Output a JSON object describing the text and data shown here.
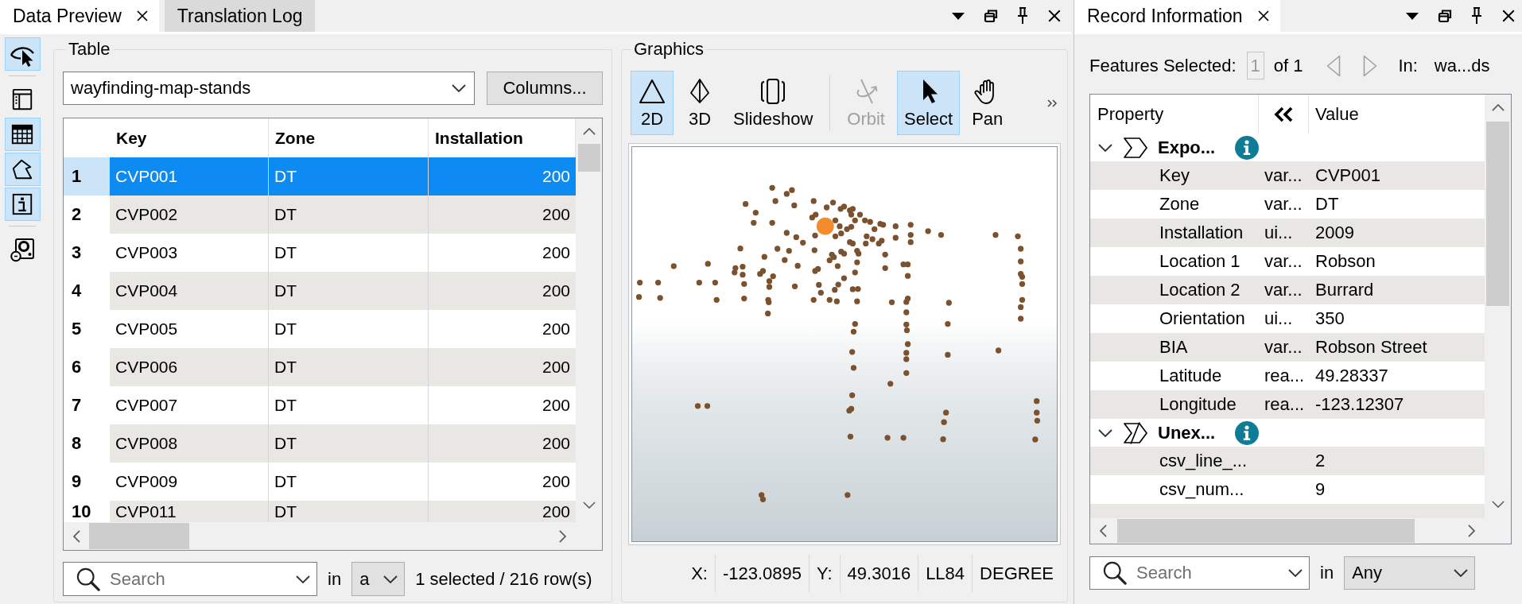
{
  "left_dock": {
    "tabs": [
      {
        "label": "Data Preview",
        "selected": true
      },
      {
        "label": "Translation Log",
        "selected": false
      }
    ],
    "side_toolbar": [
      {
        "buttons": [
          {
            "kind": "view",
            "selected": true
          }
        ]
      },
      {
        "buttons": [
          {
            "kind": "layout",
            "selected": false
          },
          {
            "kind": "table",
            "selected": true
          },
          {
            "kind": "polygon",
            "selected": true
          },
          {
            "kind": "info",
            "selected": true
          }
        ]
      },
      {
        "buttons": [
          {
            "kind": "disc",
            "selected": false
          }
        ]
      }
    ],
    "table_panel": {
      "title": "Table",
      "dataset": "wayfinding-map-stands",
      "columns_button": "Columns...",
      "table": {
        "columns": [
          "Key",
          "Zone",
          "Installation"
        ],
        "rows": [
          {
            "number": "1",
            "selected": true,
            "cells": [
              "CVP001",
              "DT",
              "200"
            ]
          },
          {
            "number": "2",
            "selected": false,
            "cells": [
              "CVP002",
              "DT",
              "200"
            ]
          },
          {
            "number": "3",
            "selected": false,
            "cells": [
              "CVP003",
              "DT",
              "200"
            ]
          },
          {
            "number": "4",
            "selected": false,
            "cells": [
              "CVP004",
              "DT",
              "200"
            ]
          },
          {
            "number": "5",
            "selected": false,
            "cells": [
              "CVP005",
              "DT",
              "200"
            ]
          },
          {
            "number": "6",
            "selected": false,
            "cells": [
              "CVP006",
              "DT",
              "200"
            ]
          },
          {
            "number": "7",
            "selected": false,
            "cells": [
              "CVP007",
              "DT",
              "200"
            ]
          },
          {
            "number": "8",
            "selected": false,
            "cells": [
              "CVP008",
              "DT",
              "200"
            ]
          },
          {
            "number": "9",
            "selected": false,
            "cells": [
              "CVP009",
              "DT",
              "200"
            ]
          },
          {
            "number": "10",
            "selected": false,
            "cells": [
              "CVP011",
              "DT",
              "200"
            ]
          }
        ]
      },
      "search": {
        "placeholder": "Search"
      },
      "scope_label": "in",
      "scope": "a",
      "status": "1 selected / 216 row(s)"
    },
    "graphics_panel": {
      "title": "Graphics",
      "toolbar": [
        {
          "tools": [
            {
              "kind": "flat",
              "label": "2D",
              "selected": true,
              "disabled": false
            },
            {
              "kind": "perspective",
              "label": "3D",
              "selected": false,
              "disabled": false
            },
            {
              "kind": "slideshow",
              "label": "Slideshow",
              "selected": false,
              "disabled": false
            }
          ]
        },
        {
          "tools": [
            {
              "kind": "orbit",
              "label": "Orbit",
              "selected": false,
              "disabled": true
            },
            {
              "kind": "select",
              "label": "Select",
              "selected": true,
              "disabled": false
            },
            {
              "kind": "pan",
              "label": "Pan",
              "selected": false,
              "disabled": false
            }
          ]
        }
      ],
      "status_bar": [
        "X:",
        "-123.0895",
        "Y:",
        "49.3016",
        "LL84",
        "DEGREE"
      ]
    }
  },
  "right_dock": {
    "tabs": [
      {
        "label": "Record Information",
        "selected": true
      }
    ],
    "features": {
      "label": "Features Selected:",
      "current": "1",
      "total": "of 1",
      "navigation": [
        {
          "kind": "previous",
          "disabled": true
        },
        {
          "kind": "next",
          "disabled": true
        }
      ],
      "source_label": "In:",
      "source": "wa...ds"
    },
    "property_grid": {
      "columns": [
        "Property",
        "Value"
      ],
      "groups": [
        {
          "kind": "exposed",
          "name": "Expo...",
          "expanded": true,
          "rows": [
            {
              "property": "Key",
              "type": "var...",
              "value": "CVP001"
            },
            {
              "property": "Zone",
              "type": "var...",
              "value": "DT"
            },
            {
              "property": "Installation",
              "type": "ui...",
              "value": "2009"
            },
            {
              "property": "Location 1",
              "type": "var...",
              "value": "Robson"
            },
            {
              "property": "Location 2",
              "type": "var...",
              "value": "Burrard"
            },
            {
              "property": "Orientation",
              "type": "ui...",
              "value": "350"
            },
            {
              "property": "BIA",
              "type": "var...",
              "value": "Robson Street"
            },
            {
              "property": "Latitude",
              "type": "rea...",
              "value": "49.28337"
            },
            {
              "property": "Longitude",
              "type": "rea...",
              "value": "-123.12307"
            }
          ]
        },
        {
          "kind": "unexposed",
          "name": "Unex...",
          "expanded": true,
          "rows": [
            {
              "property": "csv_line_...",
              "value": "2"
            },
            {
              "property": "csv_num...",
              "value": "9"
            }
          ]
        }
      ]
    },
    "search": {
      "placeholder": "Search"
    },
    "scope_label": "in",
    "scope": "Any"
  }
}
